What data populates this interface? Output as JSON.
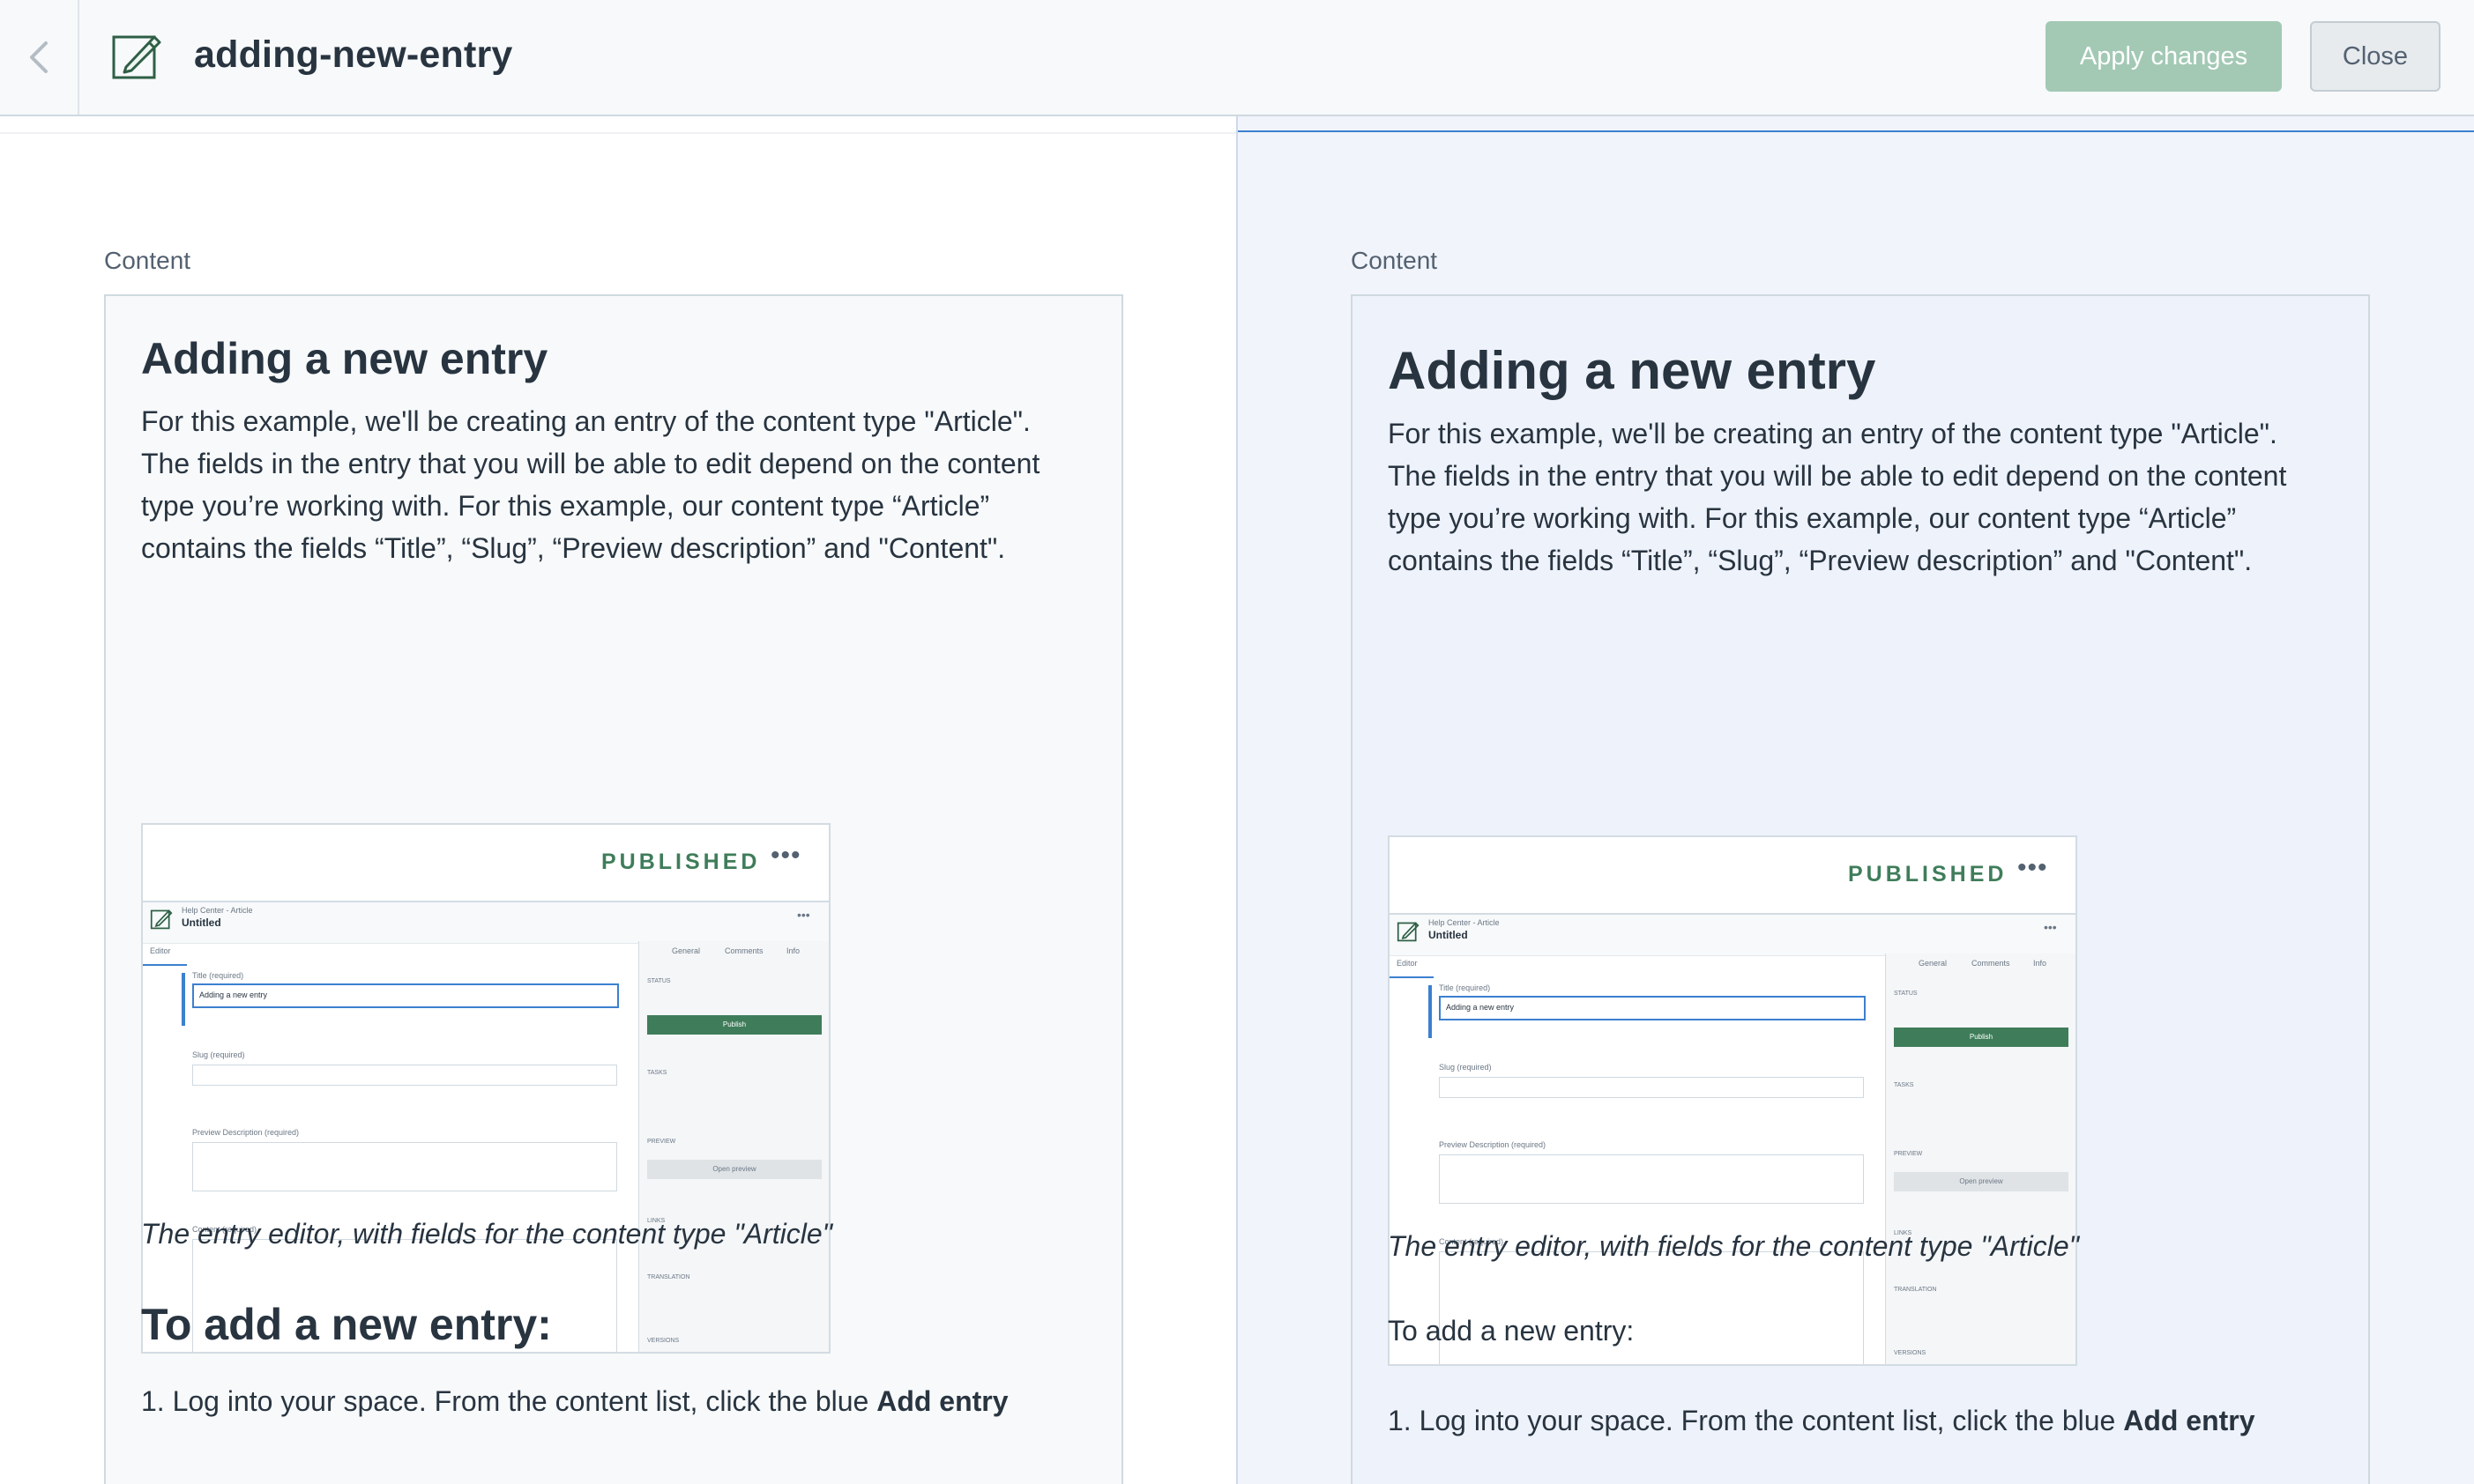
{
  "topbar": {
    "title": "adding-new-entry",
    "apply_label": "Apply changes",
    "close_label": "Close"
  },
  "left": {
    "field_label": "Content",
    "heading": "Adding a new entry",
    "paragraph_lines": [
      "For this example, we'll be creating an entry of the content type \"Article\".",
      "The fields in the entry that you will be able to edit depend on the content",
      "type you’re working with. For this example, our content type “Article”",
      "contains the fields “Title”, “Slug”, “Preview description” and \"Content\"."
    ],
    "caption": "The entry editor, with fields for the content type \"Article\"",
    "subheading": "To add a new entry:",
    "step1_pre": "1. Log into your space. From the content list, click the blue ",
    "step1_bold": "Add entry"
  },
  "right": {
    "field_label": "Content",
    "heading": "Adding a new entry",
    "paragraph_lines": [
      "For this example, we'll be creating an entry of the content type \"Article\".",
      "The fields in the entry that you will be able to edit depend on the content",
      "type you’re working with. For this example, our content type “Article”",
      "contains the fields “Title”, “Slug”, “Preview description” and \"Content\"."
    ],
    "caption": "The entry editor, with fields for the content type \"Article\"",
    "subheading": "To add a new entry:",
    "step1_pre": "1. Log into your space. From the content list, click the blue ",
    "step1_bold": "Add entry"
  },
  "thumbnail": {
    "status": "PUBLISHED",
    "more": "•••",
    "breadcrumb": "Help Center - Article",
    "entry_name": "Untitled",
    "tab_editor": "Editor",
    "tab_general": "General",
    "tab_comments": "Comments",
    "tab_info": "Info",
    "title_label": "Title (required)",
    "title_value": "Adding a new entry",
    "slug_label": "Slug (required)",
    "preview_label": "Preview Description (required)",
    "content_label": "Content (required)",
    "status_label": "STATUS",
    "publish_label": "Publish",
    "tasks_label": "TASKS",
    "preview_section": "PREVIEW",
    "open_preview": "Open preview",
    "links_label": "LINKS",
    "translation_label": "TRANSLATION",
    "versions_label": "VERSIONS"
  },
  "colors": {
    "apply_bg": "#a3c9b5",
    "published_green": "#3f7d5a",
    "focus_blue": "#3c80cf"
  }
}
